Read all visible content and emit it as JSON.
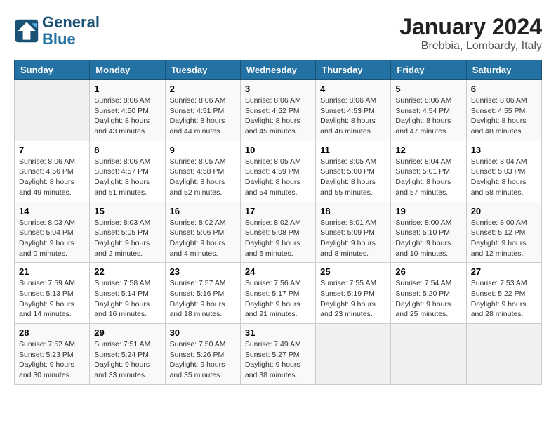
{
  "logo": {
    "line1": "General",
    "line2": "Blue"
  },
  "title": "January 2024",
  "subtitle": "Brebbia, Lombardy, Italy",
  "days_of_week": [
    "Sunday",
    "Monday",
    "Tuesday",
    "Wednesday",
    "Thursday",
    "Friday",
    "Saturday"
  ],
  "weeks": [
    [
      {
        "day": "",
        "info": ""
      },
      {
        "day": "1",
        "info": "Sunrise: 8:06 AM\nSunset: 4:50 PM\nDaylight: 8 hours\nand 43 minutes."
      },
      {
        "day": "2",
        "info": "Sunrise: 8:06 AM\nSunset: 4:51 PM\nDaylight: 8 hours\nand 44 minutes."
      },
      {
        "day": "3",
        "info": "Sunrise: 8:06 AM\nSunset: 4:52 PM\nDaylight: 8 hours\nand 45 minutes."
      },
      {
        "day": "4",
        "info": "Sunrise: 8:06 AM\nSunset: 4:53 PM\nDaylight: 8 hours\nand 46 minutes."
      },
      {
        "day": "5",
        "info": "Sunrise: 8:06 AM\nSunset: 4:54 PM\nDaylight: 8 hours\nand 47 minutes."
      },
      {
        "day": "6",
        "info": "Sunrise: 8:06 AM\nSunset: 4:55 PM\nDaylight: 8 hours\nand 48 minutes."
      }
    ],
    [
      {
        "day": "7",
        "info": "Sunrise: 8:06 AM\nSunset: 4:56 PM\nDaylight: 8 hours\nand 49 minutes."
      },
      {
        "day": "8",
        "info": "Sunrise: 8:06 AM\nSunset: 4:57 PM\nDaylight: 8 hours\nand 51 minutes."
      },
      {
        "day": "9",
        "info": "Sunrise: 8:05 AM\nSunset: 4:58 PM\nDaylight: 8 hours\nand 52 minutes."
      },
      {
        "day": "10",
        "info": "Sunrise: 8:05 AM\nSunset: 4:59 PM\nDaylight: 8 hours\nand 54 minutes."
      },
      {
        "day": "11",
        "info": "Sunrise: 8:05 AM\nSunset: 5:00 PM\nDaylight: 8 hours\nand 55 minutes."
      },
      {
        "day": "12",
        "info": "Sunrise: 8:04 AM\nSunset: 5:01 PM\nDaylight: 8 hours\nand 57 minutes."
      },
      {
        "day": "13",
        "info": "Sunrise: 8:04 AM\nSunset: 5:03 PM\nDaylight: 8 hours\nand 58 minutes."
      }
    ],
    [
      {
        "day": "14",
        "info": "Sunrise: 8:03 AM\nSunset: 5:04 PM\nDaylight: 9 hours\nand 0 minutes."
      },
      {
        "day": "15",
        "info": "Sunrise: 8:03 AM\nSunset: 5:05 PM\nDaylight: 9 hours\nand 2 minutes."
      },
      {
        "day": "16",
        "info": "Sunrise: 8:02 AM\nSunset: 5:06 PM\nDaylight: 9 hours\nand 4 minutes."
      },
      {
        "day": "17",
        "info": "Sunrise: 8:02 AM\nSunset: 5:08 PM\nDaylight: 9 hours\nand 6 minutes."
      },
      {
        "day": "18",
        "info": "Sunrise: 8:01 AM\nSunset: 5:09 PM\nDaylight: 9 hours\nand 8 minutes."
      },
      {
        "day": "19",
        "info": "Sunrise: 8:00 AM\nSunset: 5:10 PM\nDaylight: 9 hours\nand 10 minutes."
      },
      {
        "day": "20",
        "info": "Sunrise: 8:00 AM\nSunset: 5:12 PM\nDaylight: 9 hours\nand 12 minutes."
      }
    ],
    [
      {
        "day": "21",
        "info": "Sunrise: 7:59 AM\nSunset: 5:13 PM\nDaylight: 9 hours\nand 14 minutes."
      },
      {
        "day": "22",
        "info": "Sunrise: 7:58 AM\nSunset: 5:14 PM\nDaylight: 9 hours\nand 16 minutes."
      },
      {
        "day": "23",
        "info": "Sunrise: 7:57 AM\nSunset: 5:16 PM\nDaylight: 9 hours\nand 18 minutes."
      },
      {
        "day": "24",
        "info": "Sunrise: 7:56 AM\nSunset: 5:17 PM\nDaylight: 9 hours\nand 21 minutes."
      },
      {
        "day": "25",
        "info": "Sunrise: 7:55 AM\nSunset: 5:19 PM\nDaylight: 9 hours\nand 23 minutes."
      },
      {
        "day": "26",
        "info": "Sunrise: 7:54 AM\nSunset: 5:20 PM\nDaylight: 9 hours\nand 25 minutes."
      },
      {
        "day": "27",
        "info": "Sunrise: 7:53 AM\nSunset: 5:22 PM\nDaylight: 9 hours\nand 28 minutes."
      }
    ],
    [
      {
        "day": "28",
        "info": "Sunrise: 7:52 AM\nSunset: 5:23 PM\nDaylight: 9 hours\nand 30 minutes."
      },
      {
        "day": "29",
        "info": "Sunrise: 7:51 AM\nSunset: 5:24 PM\nDaylight: 9 hours\nand 33 minutes."
      },
      {
        "day": "30",
        "info": "Sunrise: 7:50 AM\nSunset: 5:26 PM\nDaylight: 9 hours\nand 35 minutes."
      },
      {
        "day": "31",
        "info": "Sunrise: 7:49 AM\nSunset: 5:27 PM\nDaylight: 9 hours\nand 38 minutes."
      },
      {
        "day": "",
        "info": ""
      },
      {
        "day": "",
        "info": ""
      },
      {
        "day": "",
        "info": ""
      }
    ]
  ]
}
